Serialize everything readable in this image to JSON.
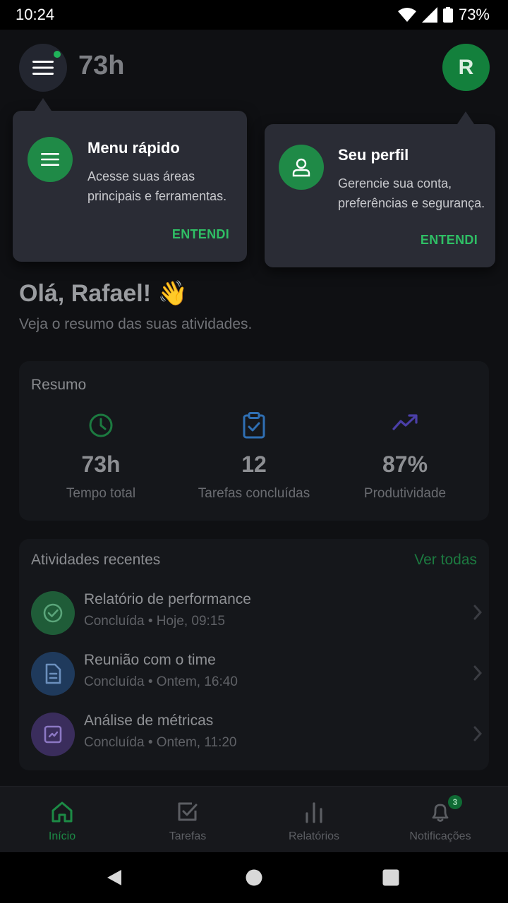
{
  "status_bar": {
    "time": "10:24",
    "battery": "73%"
  },
  "header": {
    "hours": "73h",
    "avatar_initial": "R"
  },
  "tooltips": {
    "menu": {
      "title": "Menu rápido",
      "text_line1": "Acesse suas áreas",
      "text_line2": "principais e ferramentas.",
      "action": "ENTENDI",
      "icon": "menu-icon"
    },
    "profile": {
      "title": "Seu perfil",
      "text_line1": "Gerencie sua conta,",
      "text_line2": "preferências e segurança.",
      "action": "ENTENDI",
      "icon": "user-icon"
    }
  },
  "greeting": {
    "title": "Olá, Rafael! 👋",
    "subtitle": "Veja o resumo das suas atividades."
  },
  "summary": {
    "title": "Resumo",
    "stats": [
      {
        "value": "73h",
        "label": "Tempo total",
        "icon": "clock-icon",
        "color": "#1c7a40"
      },
      {
        "value": "12",
        "label": "Tarefas concluídas",
        "icon": "clipboard-check-icon",
        "color": "#2f6fb3"
      },
      {
        "value": "87%",
        "label": "Produtividade",
        "icon": "trending-up-icon",
        "color": "#4b3fa8"
      }
    ]
  },
  "activities": {
    "title": "Atividades recentes",
    "see_all": "Ver todas",
    "items": [
      {
        "title": "Relatório de performance",
        "subtitle": "Concluída • Hoje, 09:15",
        "icon": "check-circle-icon",
        "color": "#1f5c38"
      },
      {
        "title": "Reunião com o time",
        "subtitle": "Concluída • Ontem, 16:40",
        "icon": "document-icon",
        "color": "#1f3a5c"
      },
      {
        "title": "Análise de métricas",
        "subtitle": "Concluída • Ontem, 11:20",
        "icon": "chart-box-icon",
        "color": "#3a2d5c"
      }
    ]
  },
  "bottom_nav": {
    "items": [
      {
        "label": "Início",
        "icon": "home-icon",
        "active": true
      },
      {
        "label": "Tarefas",
        "icon": "checkbox-icon",
        "active": false
      },
      {
        "label": "Relatórios",
        "icon": "bar-chart-icon",
        "active": false
      },
      {
        "label": "Notificações",
        "icon": "bell-icon",
        "active": false,
        "badge": "3"
      }
    ]
  },
  "colors": {
    "accent": "#20b35a",
    "background": "#0f1013",
    "card": "#15171b",
    "tooltip": "#2a2c35"
  }
}
